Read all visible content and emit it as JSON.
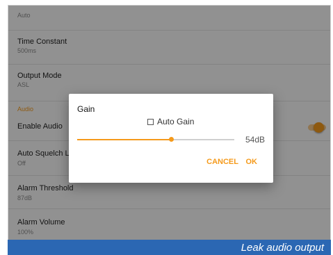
{
  "colors": {
    "accent": "#f59a1b",
    "caption_bg": "#2b67b3",
    "scrim": "rgba(0,0,0,0.42)"
  },
  "settings": {
    "items": [
      {
        "title": "",
        "value": "Auto"
      },
      {
        "title": "Time Constant",
        "value": "500ms"
      },
      {
        "title": "Output Mode",
        "value": "ASL"
      }
    ],
    "audio_section": {
      "header": "Audio",
      "enable_audio": {
        "title": "Enable Audio",
        "toggle_on": true
      },
      "items": [
        {
          "title": "Auto Squelch L",
          "value": "Off"
        },
        {
          "title": "Alarm Threshold",
          "value": "87dB"
        },
        {
          "title": "Alarm Volume",
          "value": "100%"
        }
      ]
    }
  },
  "dialog": {
    "title": "Gain",
    "auto_gain_label": "Auto Gain",
    "auto_gain_checked": false,
    "slider_fraction": 0.6,
    "value_text": "54dB",
    "cancel_label": "CANCEL",
    "ok_label": "OK"
  },
  "caption": "Leak audio output"
}
